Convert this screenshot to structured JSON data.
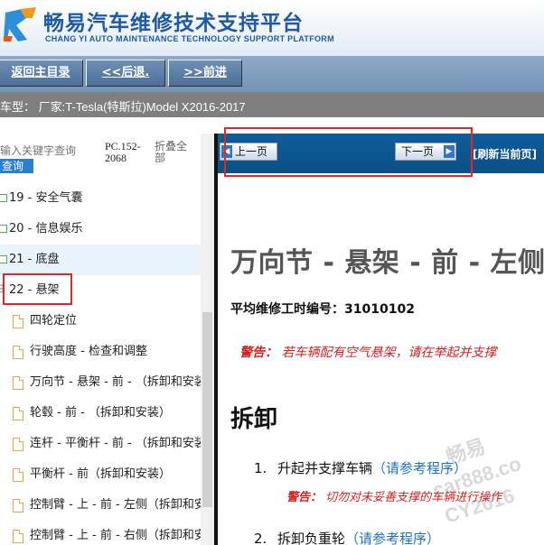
{
  "header": {
    "title_cn": "畅易汽车维修技术支持平台",
    "title_en": "CHANG YI AUTO MAINTENANCE TECHNOLOGY SUPPORT PLATFORM"
  },
  "nav": {
    "home": "返回主目录",
    "back": "<<后退.",
    "forward": ">>前进"
  },
  "model_bar": {
    "text": "车型：  厂家:T-Tesla(特斯拉)Model X2016-2017"
  },
  "left_panel": {
    "search_placeholder": "输入关键字查询",
    "query_button": "查询",
    "pc_ref": "PC.152-2068",
    "collapse_all": "折叠全部",
    "tree": [
      {
        "label": "19 - 安全气囊",
        "type": "folder"
      },
      {
        "label": "20 - 信息娱乐",
        "type": "folder"
      },
      {
        "label": "21 - 底盘",
        "type": "folder",
        "selected": true
      },
      {
        "label": "22 - 悬架",
        "type": "expanded"
      },
      {
        "label": "四轮定位",
        "type": "doc"
      },
      {
        "label": "行驶高度 - 检查和调整",
        "type": "doc"
      },
      {
        "label": "万向节 - 悬架 - 前 - （拆卸和安装）",
        "type": "doc"
      },
      {
        "label": "轮毂 - 前 - （拆卸和安装）",
        "type": "doc"
      },
      {
        "label": "连杆 - 平衡杆 - 前 - （拆卸和安装）",
        "type": "doc"
      },
      {
        "label": "平衡杆 - 前（拆卸和安装）",
        "type": "doc"
      },
      {
        "label": "控制臂 - 上 - 前 - 左侧（拆卸和安装）",
        "type": "doc"
      },
      {
        "label": "控制臂 - 上 - 前 - 右侧（拆卸和安装）",
        "type": "doc"
      }
    ]
  },
  "right_panel": {
    "prev_page": "上一页",
    "next_page": "下一页",
    "refresh": "[刷新当前页]",
    "doc_title": "万向节 - 悬架 - 前 - 左侧",
    "labor_code": "平均维修工时编号：31010102",
    "warning_label": "警告：",
    "warning_text": "若车辆配有空气悬架，请在举起并支撑",
    "section": "拆卸",
    "steps": [
      {
        "num": "1.",
        "text": "升起并支撑车辆",
        "link": "（请参考程序）"
      },
      {
        "num": "2.",
        "text": "拆卸负重轮",
        "link": "（请参考程序）"
      }
    ],
    "step1_warning_label": "警告：",
    "step1_warning_text": "切勿对未妥善支撑的车辆进行操作"
  },
  "watermark": {
    "line1": "畅易",
    "line2": "car888.co",
    "line3": "CY2016"
  },
  "colors": {
    "brand_blue": "#1e5aa8",
    "nav_bar": "#7394b8",
    "page_bar": "#0b4f86",
    "warning_red": "#d32222",
    "highlight_red": "#e02828",
    "link_blue": "#1e73be"
  }
}
